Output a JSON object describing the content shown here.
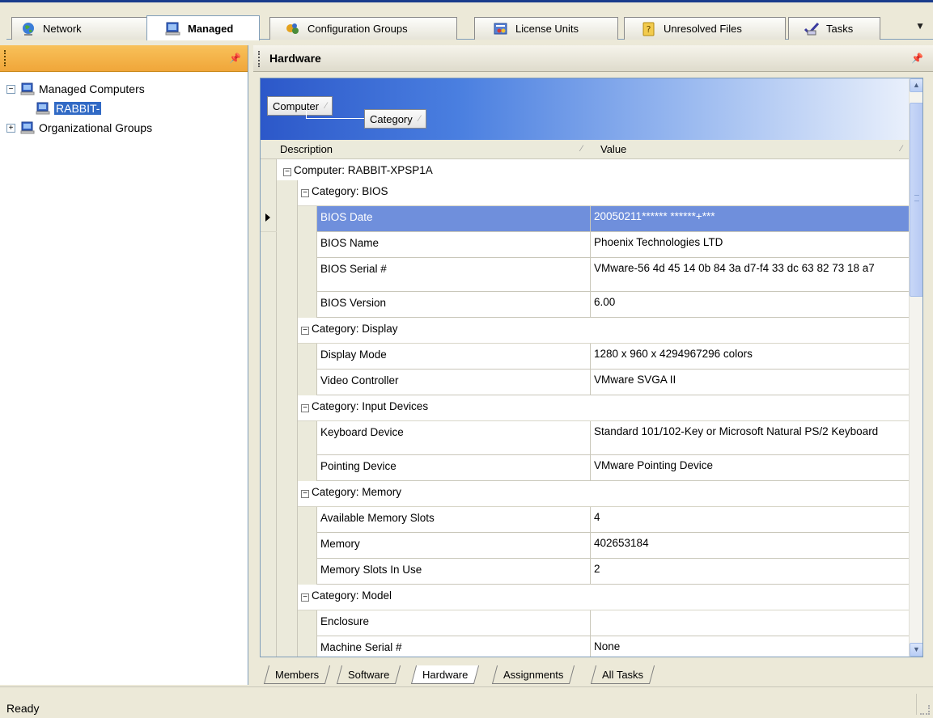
{
  "tabs": [
    {
      "label": "Network",
      "icon": "globe-icon"
    },
    {
      "label": "Managed",
      "icon": "computer-icon",
      "active": true
    },
    {
      "label": "Configuration Groups",
      "icon": "config-groups-icon"
    },
    {
      "label": "License Units",
      "icon": "license-icon"
    },
    {
      "label": "Unresolved Files",
      "icon": "unresolved-file-icon"
    },
    {
      "label": "Tasks",
      "icon": "tasks-check-icon"
    }
  ],
  "tree": {
    "managed_computers": "Managed Computers",
    "rabbit": "RABBIT-",
    "org_groups": "Organizational Groups"
  },
  "right_panel": {
    "title": "Hardware",
    "group_chips": {
      "computer": "Computer",
      "category": "Category"
    },
    "columns": {
      "description": "Description",
      "value": "Value"
    },
    "computer_group": "Computer: RABBIT-XPSP1A",
    "categories": [
      {
        "label": "Category: BIOS",
        "rows": [
          {
            "desc": "BIOS Date",
            "value": "20050211****** ******+***",
            "selected": true
          },
          {
            "desc": "BIOS Name",
            "value": "Phoenix Technologies LTD"
          },
          {
            "desc": "BIOS Serial #",
            "value": "VMware-56 4d 45 14 0b 84 3a d7-f4 33 dc 63 82 73 18 a7"
          },
          {
            "desc": "BIOS Version",
            "value": "6.00"
          }
        ]
      },
      {
        "label": "Category: Display",
        "rows": [
          {
            "desc": "Display Mode",
            "value": "1280 x 960 x 4294967296 colors"
          },
          {
            "desc": "Video Controller",
            "value": "VMware SVGA II"
          }
        ]
      },
      {
        "label": "Category: Input Devices",
        "rows": [
          {
            "desc": "Keyboard Device",
            "value": "Standard 101/102-Key or Microsoft Natural PS/2 Keyboard"
          },
          {
            "desc": "Pointing Device",
            "value": "VMware Pointing Device"
          }
        ]
      },
      {
        "label": "Category: Memory",
        "rows": [
          {
            "desc": "Available Memory Slots",
            "value": "4"
          },
          {
            "desc": "Memory",
            "value": "402653184"
          },
          {
            "desc": "Memory Slots In Use",
            "value": "2"
          }
        ]
      },
      {
        "label": "Category: Model",
        "rows": [
          {
            "desc": "Enclosure",
            "value": ""
          },
          {
            "desc": "Machine Serial #",
            "value": "None"
          }
        ]
      }
    ]
  },
  "bottom_tabs": [
    "Members",
    "Software",
    "Hardware",
    "Assignments",
    "All Tasks"
  ],
  "status": {
    "text": "Ready"
  },
  "colors": {
    "accent_blue": "#316ac5",
    "selected_row": "#6f8fdc",
    "panel_header_orange": "#f0a63a"
  }
}
